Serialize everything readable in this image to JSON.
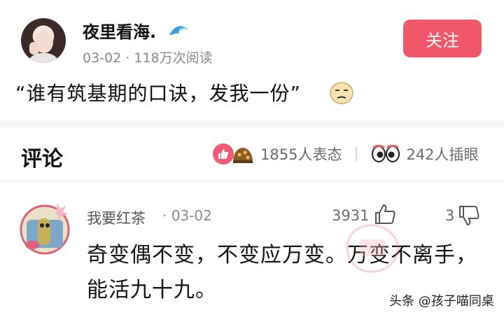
{
  "post": {
    "username": "夜里看海.",
    "date": "03-02",
    "separator": "·",
    "reads": "118万次阅读",
    "follow_label": "关注",
    "text": "“谁有筑基期的口诀，发我一份”",
    "wave_icon": "wave-icon",
    "emoji_icon": "awkward-face-icon"
  },
  "comments_header": {
    "title": "评论",
    "reaction_count": "1855人表态",
    "watch_count": "242人插眼"
  },
  "comment": {
    "user": "我要红茶",
    "time": "· 03-02",
    "like_count": "3931",
    "dislike_count": "3",
    "text": "奇变偶不变，不变应万变。万变不离手，能活九十九。"
  },
  "watermark": "头条 @孩子喵同桌",
  "colors": {
    "follow_button": "#f1576b",
    "like_reaction": "#f25b77",
    "meta_text": "#8a8a8a"
  }
}
